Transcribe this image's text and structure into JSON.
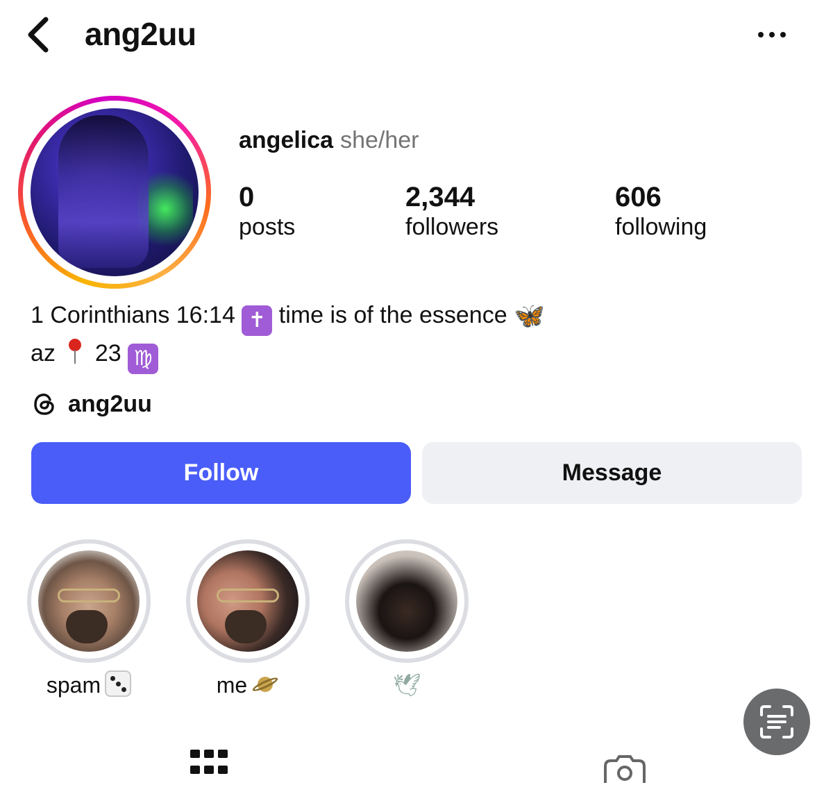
{
  "header": {
    "username": "ang2uu",
    "back_icon": "chevron-left-icon",
    "more_icon": "more-horizontal-icon"
  },
  "profile": {
    "display_name": "angelica",
    "pronouns": "she/her",
    "avatar_ring_colors": [
      "#f8b400",
      "#fb5a2a",
      "#e1166f",
      "#d300c5"
    ]
  },
  "stats": {
    "posts": {
      "count": "0",
      "label": "posts"
    },
    "followers": {
      "count": "2,344",
      "label": "followers"
    },
    "following": {
      "count": "606",
      "label": "following"
    }
  },
  "bio": {
    "line1_text": "1 Corinthians 16:14",
    "line1_emoji_cross": "✝",
    "line1_text2": "time is of the essence",
    "line1_emoji_butterfly": "🦋",
    "line2_text": "az",
    "line2_emoji_pin": "📍",
    "line2_text2": "23",
    "line2_emoji_virgo": "♍"
  },
  "threads": {
    "icon": "threads-icon",
    "handle": "ang2uu"
  },
  "actions": {
    "follow_label": "Follow",
    "message_label": "Message",
    "follow_color": "#4a5df9",
    "message_color": "#eff0f4"
  },
  "highlights": [
    {
      "caption": "spam",
      "emoji": "🎲"
    },
    {
      "caption": "me",
      "emoji": "🪐"
    },
    {
      "caption": "",
      "emoji": "🕊"
    }
  ],
  "tabs": [
    {
      "icon": "grid-icon",
      "active": true
    },
    {
      "icon": "tagged-photos-icon",
      "active": false
    }
  ],
  "floating": {
    "icon": "text-scan-icon"
  }
}
